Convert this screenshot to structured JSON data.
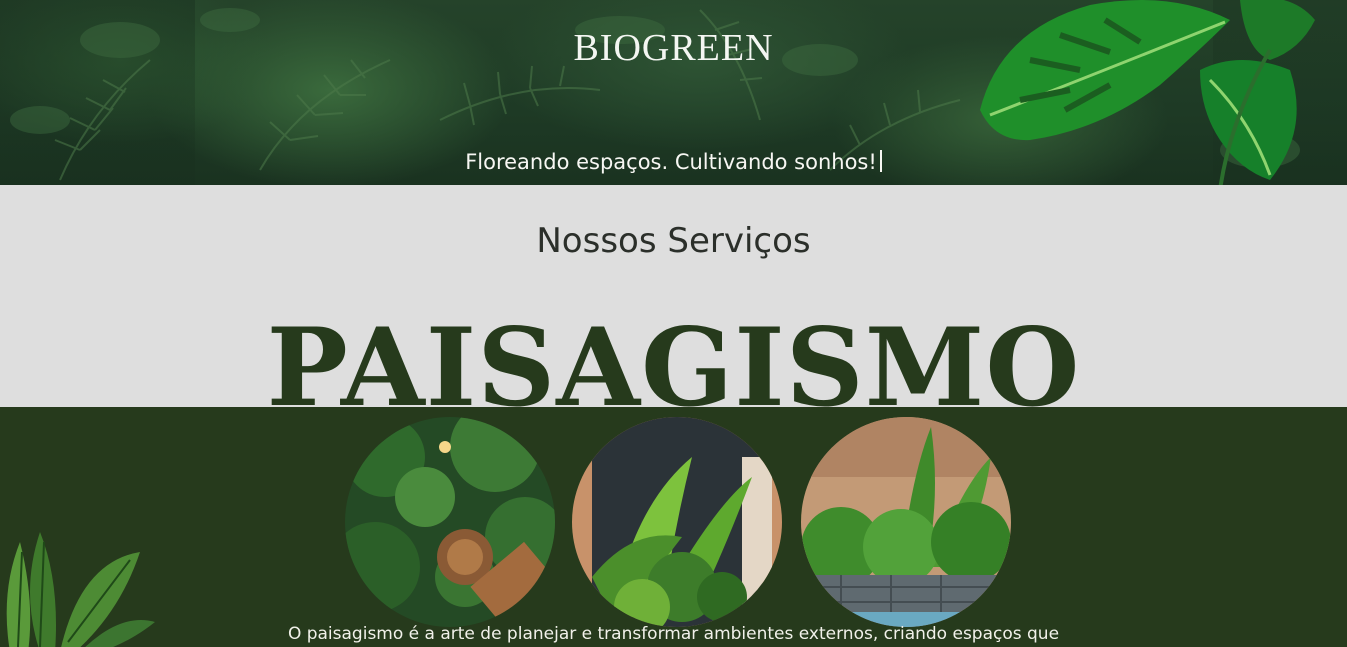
{
  "header": {
    "brand": "BIOGREEN",
    "tagline": "Floreando espaços. Cultivando sonhos!"
  },
  "services": {
    "title": "Nossos Serviços",
    "heading": "PAISAGISMO"
  },
  "landscaping": {
    "photos": [
      {
        "name": "vertical-garden-with-deck"
      },
      {
        "name": "indoor-tropical-garden"
      },
      {
        "name": "pool-side-garden"
      }
    ],
    "description": "O paisagismo é a arte de planejar e transformar ambientes externos, criando espaços que"
  },
  "colors": {
    "dark_green": "#263a1c",
    "light_gray": "#dedede",
    "text_light": "#f4f6f2"
  }
}
